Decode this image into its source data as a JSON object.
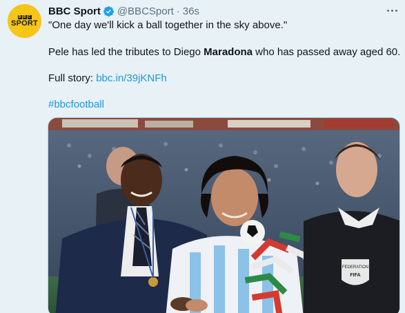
{
  "account": {
    "avatar_icon": "bbc-sport-logo",
    "avatar_brand": [
      "B",
      "B",
      "C"
    ],
    "avatar_text": "SPORT",
    "name": "BBC Sport",
    "handle": "@BBCSport",
    "separator": "·",
    "time": "36s"
  },
  "tweet": {
    "line1": "\"One day we'll kick a ball together in the sky above.\"",
    "line2_before": "Pele has led the tributes to Diego ",
    "line2_bold": "Maradona",
    "line2_after": " who has passed away aged 60.",
    "line3_label": "Full story: ",
    "line3_link": "bbc.in/39jKNFh",
    "hashtag": "#bbcfootball"
  },
  "media": {
    "image_icon": "photo-pele-maradona",
    "badge_text": [
      "FEDERATION",
      "FIFA"
    ]
  },
  "icons": {
    "verified": "verified-badge-icon",
    "more": "more-options-icon"
  },
  "colors": {
    "background": "#e8f1f6",
    "link": "#1b95e0",
    "secondary_text": "#5b7083",
    "avatar": "#f5c518",
    "verified": "#1da1f2"
  }
}
